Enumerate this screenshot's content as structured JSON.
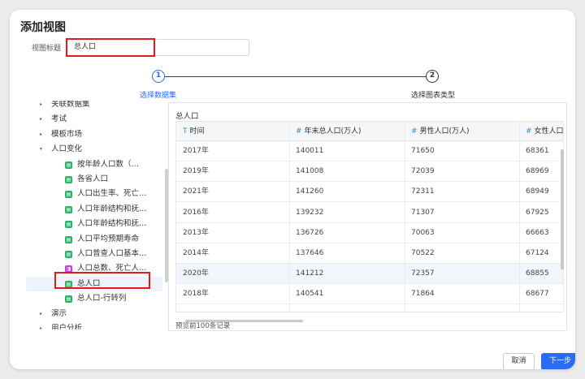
{
  "dialog": {
    "title": "添加视图",
    "view_title_label": "视图标题",
    "view_title_value": "总人口"
  },
  "steps": [
    {
      "num": "1",
      "label": "选择数据集"
    },
    {
      "num": "2",
      "label": "选择图表类型"
    }
  ],
  "tree": {
    "items": [
      {
        "label": "关联数据集",
        "type": "folder",
        "expanded": false
      },
      {
        "label": "考试",
        "type": "folder",
        "expanded": false
      },
      {
        "label": "模板市场",
        "type": "folder",
        "expanded": false
      },
      {
        "label": "人口变化",
        "type": "folder",
        "expanded": true
      },
      {
        "label": "按年龄人口数（…",
        "type": "dataset"
      },
      {
        "label": "各省人口",
        "type": "dataset"
      },
      {
        "label": "人口出生率、死亡…",
        "type": "dataset"
      },
      {
        "label": "人口年龄结构和抚…",
        "type": "dataset"
      },
      {
        "label": "人口年龄结构和抚…",
        "type": "dataset"
      },
      {
        "label": "人口平均预期寿命",
        "type": "dataset"
      },
      {
        "label": "人口普查人口基本…",
        "type": "dataset"
      },
      {
        "label": "人口总数、死亡人…",
        "type": "union"
      },
      {
        "label": "总人口",
        "type": "dataset",
        "selected": true
      },
      {
        "label": "总人口-行转列",
        "type": "dataset"
      },
      {
        "label": "演示",
        "type": "folder",
        "expanded": false
      },
      {
        "label": "用户分析",
        "type": "folder",
        "expanded": false
      }
    ]
  },
  "preview": {
    "title": "总人口",
    "columns": [
      {
        "type_icon": "T",
        "name": "时间"
      },
      {
        "type_icon": "#",
        "name": "年末总人口(万人)"
      },
      {
        "type_icon": "#",
        "name": "男性人口(万人)"
      },
      {
        "type_icon": "#",
        "name": "女性人口("
      }
    ],
    "rows": [
      [
        "2017年",
        "140011",
        "71650",
        "68361"
      ],
      [
        "2019年",
        "141008",
        "72039",
        "68969"
      ],
      [
        "2021年",
        "141260",
        "72311",
        "68949"
      ],
      [
        "2016年",
        "139232",
        "71307",
        "67925"
      ],
      [
        "2013年",
        "136726",
        "70063",
        "66663"
      ],
      [
        "2014年",
        "137646",
        "70522",
        "67124"
      ],
      [
        "2020年",
        "141212",
        "72357",
        "68855"
      ],
      [
        "2018年",
        "140541",
        "71864",
        "68677"
      ]
    ],
    "note": "预览前100条记录"
  },
  "buttons": {
    "cancel": "取消",
    "next": "下一步"
  },
  "colors": {
    "primary": "#2b6cf7",
    "highlight": "#e21a1a",
    "dataset_icon": "#27b36b",
    "union_icon": "#c23fd6"
  },
  "icons": {
    "folder_collapsed": "▸",
    "folder_expanded": "▾",
    "dataset": "▤",
    "union": "◨"
  }
}
